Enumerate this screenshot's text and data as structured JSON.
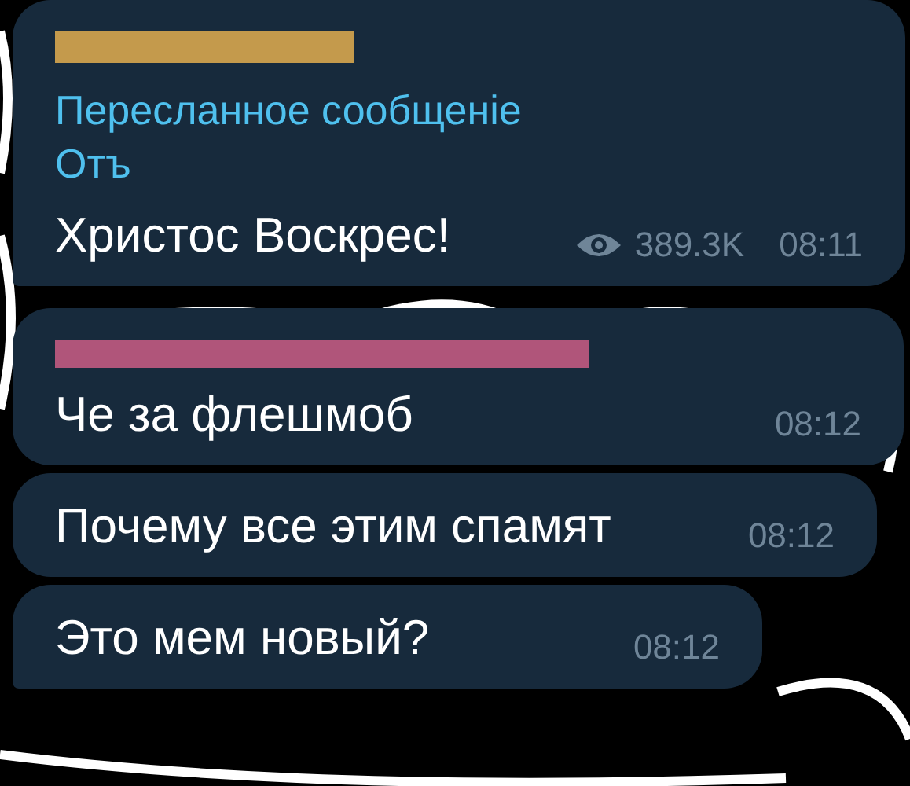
{
  "messages": [
    {
      "sender": {
        "color": "#c49a4c"
      },
      "forwarded_label": "Пересланное сообщеніе",
      "forwarded_from": "Отъ",
      "text": "Христос Воскрес!",
      "views": "389.3K",
      "time": "08:11",
      "tail": true
    },
    {
      "sender": {
        "color": "#b0557a"
      },
      "text": "Че за флешмоб",
      "time": "08:12",
      "tail": false
    },
    {
      "text": "Почему все этим спамят",
      "time": "08:12",
      "tail": false
    },
    {
      "text": "Это мем новый?",
      "time": "08:12",
      "tail": true
    }
  ]
}
